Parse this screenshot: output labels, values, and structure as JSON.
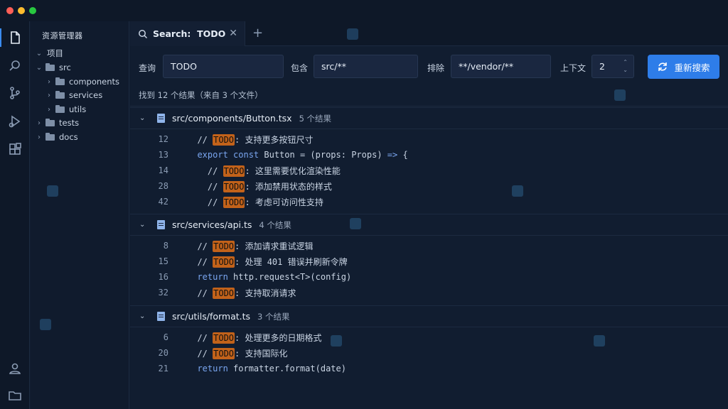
{
  "window": {
    "traffic": [
      "#ff5f57",
      "#febc2e",
      "#28c840"
    ]
  },
  "sidebar": {
    "title": "资源管理器",
    "tree": [
      {
        "label": "项目",
        "chev": "⌄",
        "folder": false
      },
      {
        "label": "src",
        "chev": "⌄",
        "folder": true
      },
      {
        "label": "components",
        "chev": "›",
        "folder": true
      },
      {
        "label": "services",
        "chev": "›",
        "folder": true
      },
      {
        "label": "utils",
        "chev": "›",
        "folder": true
      },
      {
        "label": "tests",
        "chev": "›",
        "folder": true
      },
      {
        "label": "docs",
        "chev": "›",
        "folder": true
      }
    ]
  },
  "tab": {
    "label": "Search:  TODO",
    "close": "✕",
    "new": "+"
  },
  "search": {
    "query_label": "查询",
    "query_value": "TODO",
    "include_label": "包含",
    "include_value": "src/**",
    "exclude_label": "排除",
    "exclude_value": "**/vendor/**",
    "context_label": "上下文",
    "context_value": "2",
    "button_label": "重新搜索",
    "summary": "找到 12 个结果（来自 3 个文件）"
  },
  "results": [
    {
      "file": "src/components/Button.tsx",
      "count": "5 个结果",
      "lines": [
        {
          "ln": "12",
          "parts": [
            {
              "t": "  // ",
              "c": "cmt"
            },
            {
              "t": "TODO",
              "c": "hl"
            },
            {
              "t": ": 支持更多按钮尺寸",
              "c": "cmt"
            }
          ]
        },
        {
          "ln": "13",
          "parts": [
            {
              "t": "  ",
              "c": ""
            },
            {
              "t": "export const",
              "c": "kw"
            },
            {
              "t": " Button = (props: Props) ",
              "c": ""
            },
            {
              "t": "=>",
              "c": "kw"
            },
            {
              "t": " {",
              "c": ""
            }
          ]
        },
        {
          "ln": "14",
          "parts": [
            {
              "t": "    // ",
              "c": "cmt"
            },
            {
              "t": "TODO",
              "c": "hl"
            },
            {
              "t": ": 这里需要优化渲染性能",
              "c": "cmt"
            }
          ]
        },
        {
          "ln": "28",
          "parts": [
            {
              "t": "    // ",
              "c": "cmt"
            },
            {
              "t": "TODO",
              "c": "hl"
            },
            {
              "t": ": 添加禁用状态的样式",
              "c": "cmt"
            }
          ]
        },
        {
          "ln": "42",
          "parts": [
            {
              "t": "    // ",
              "c": "cmt"
            },
            {
              "t": "TODO",
              "c": "hl"
            },
            {
              "t": ": 考虑可访问性支持",
              "c": "cmt"
            }
          ]
        }
      ]
    },
    {
      "file": "src/services/api.ts",
      "count": "4 个结果",
      "lines": [
        {
          "ln": "8",
          "parts": [
            {
              "t": "  // ",
              "c": "cmt"
            },
            {
              "t": "TODO",
              "c": "hl"
            },
            {
              "t": ": 添加请求重试逻辑",
              "c": "cmt"
            }
          ]
        },
        {
          "ln": "15",
          "parts": [
            {
              "t": "  // ",
              "c": "cmt"
            },
            {
              "t": "TODO",
              "c": "hl"
            },
            {
              "t": ": 处理 401 错误并刷新令牌",
              "c": "cmt"
            }
          ]
        },
        {
          "ln": "16",
          "parts": [
            {
              "t": "  ",
              "c": ""
            },
            {
              "t": "return",
              "c": "kw"
            },
            {
              "t": " http.request<T>(config)",
              "c": ""
            }
          ]
        },
        {
          "ln": "32",
          "parts": [
            {
              "t": "  // ",
              "c": "cmt"
            },
            {
              "t": "TODO",
              "c": "hl"
            },
            {
              "t": ": 支持取消请求",
              "c": "cmt"
            }
          ]
        }
      ]
    },
    {
      "file": "src/utils/format.ts",
      "count": "3 个结果",
      "lines": [
        {
          "ln": "6",
          "parts": [
            {
              "t": "  // ",
              "c": "cmt"
            },
            {
              "t": "TODO",
              "c": "hl"
            },
            {
              "t": ": 处理更多的日期格式",
              "c": "cmt"
            }
          ]
        },
        {
          "ln": "20",
          "parts": [
            {
              "t": "  // ",
              "c": "cmt"
            },
            {
              "t": "TODO",
              "c": "hl"
            },
            {
              "t": ": 支持国际化",
              "c": "cmt"
            }
          ]
        },
        {
          "ln": "21",
          "parts": [
            {
              "t": "  ",
              "c": ""
            },
            {
              "t": "return",
              "c": "kw"
            },
            {
              "t": " formatter.format(date)",
              "c": ""
            }
          ]
        }
      ]
    }
  ]
}
